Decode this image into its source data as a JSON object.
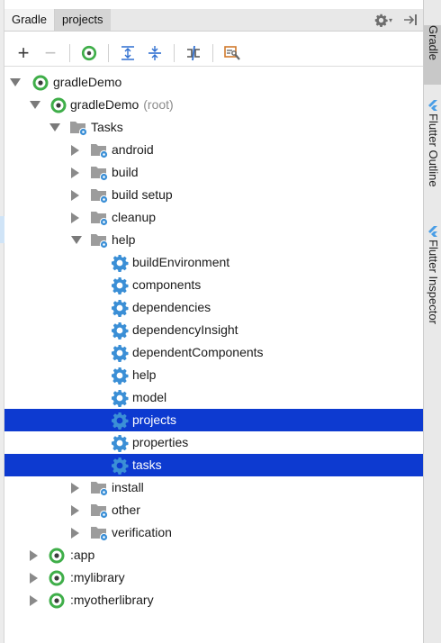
{
  "panel": {
    "tabs": [
      {
        "label": "Gradle"
      },
      {
        "label": "projects"
      }
    ]
  },
  "toolbar": {
    "add_label": "+",
    "remove_label": "−"
  },
  "tree": {
    "root": {
      "label": "gradleDemo"
    },
    "project": {
      "label": "gradleDemo",
      "suffix": "(root)"
    },
    "tasks": {
      "label": "Tasks"
    },
    "groups": [
      {
        "label": "android"
      },
      {
        "label": "build"
      },
      {
        "label": "build setup"
      },
      {
        "label": "cleanup"
      },
      {
        "label": "help"
      }
    ],
    "help_tasks": [
      {
        "label": "buildEnvironment"
      },
      {
        "label": "components"
      },
      {
        "label": "dependencies"
      },
      {
        "label": "dependencyInsight"
      },
      {
        "label": "dependentComponents"
      },
      {
        "label": "help"
      },
      {
        "label": "model"
      },
      {
        "label": "projects"
      },
      {
        "label": "properties"
      },
      {
        "label": "tasks"
      }
    ],
    "more_groups": [
      {
        "label": "install"
      },
      {
        "label": "other"
      },
      {
        "label": "verification"
      }
    ],
    "modules": [
      {
        "label": ":app"
      },
      {
        "label": ":mylibrary"
      },
      {
        "label": ":myotherlibrary"
      }
    ]
  },
  "side_tabs": [
    {
      "label": "Gradle"
    },
    {
      "label": "Flutter Outline"
    },
    {
      "label": "Flutter Inspector"
    }
  ],
  "colors": {
    "selection": "#0d3ad0",
    "gradle_green": "#3fae49",
    "gear_blue": "#3b8fd6",
    "folder_gray": "#9c9c9c"
  }
}
